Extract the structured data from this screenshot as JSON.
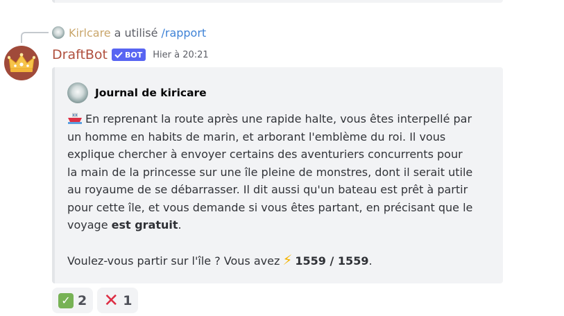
{
  "reply": {
    "user": "Kirlcare",
    "verb": "a utilisé",
    "command": "/rapport"
  },
  "message": {
    "author": "DraftBot",
    "bot_tag": "BOT",
    "timestamp": "Hier à 20:21"
  },
  "embed": {
    "author": "Journal de kiricare",
    "lines": [
      "En reprenant la route après une rapide halte, vous êtes interpellé par",
      "un homme en habits de marin, et arborant l'emblème du roi. Il vous",
      "explique chercher à envoyer certains des aventuriers concurrents pour",
      "la main de la princesse sur une île pleine de monstres, dont il serait utile",
      "au royaume de se débarrasser. Il dit aussi qu'un bateau est prêt à partir",
      "pour cette île, et vous demande si vous êtes partant, en précisant que le"
    ],
    "last_line_prefix": "voyage",
    "last_line_bold": "est gratuit",
    "last_line_suffix": ".",
    "question_prefix": "Voulez-vous partir sur l'île ? Vous avez",
    "energy": "1559 / 1559",
    "question_suffix": "."
  },
  "reactions": [
    {
      "emoji": "check-mark-icon",
      "count": "2"
    },
    {
      "emoji": "cross-mark-icon",
      "count": "1"
    }
  ],
  "colors": {
    "bot_name": "#b0503e",
    "reply_user": "#c9a66b",
    "command": "#3e82d6",
    "bot_tag": "#5865f2",
    "embed_bg": "#f2f3f5"
  }
}
